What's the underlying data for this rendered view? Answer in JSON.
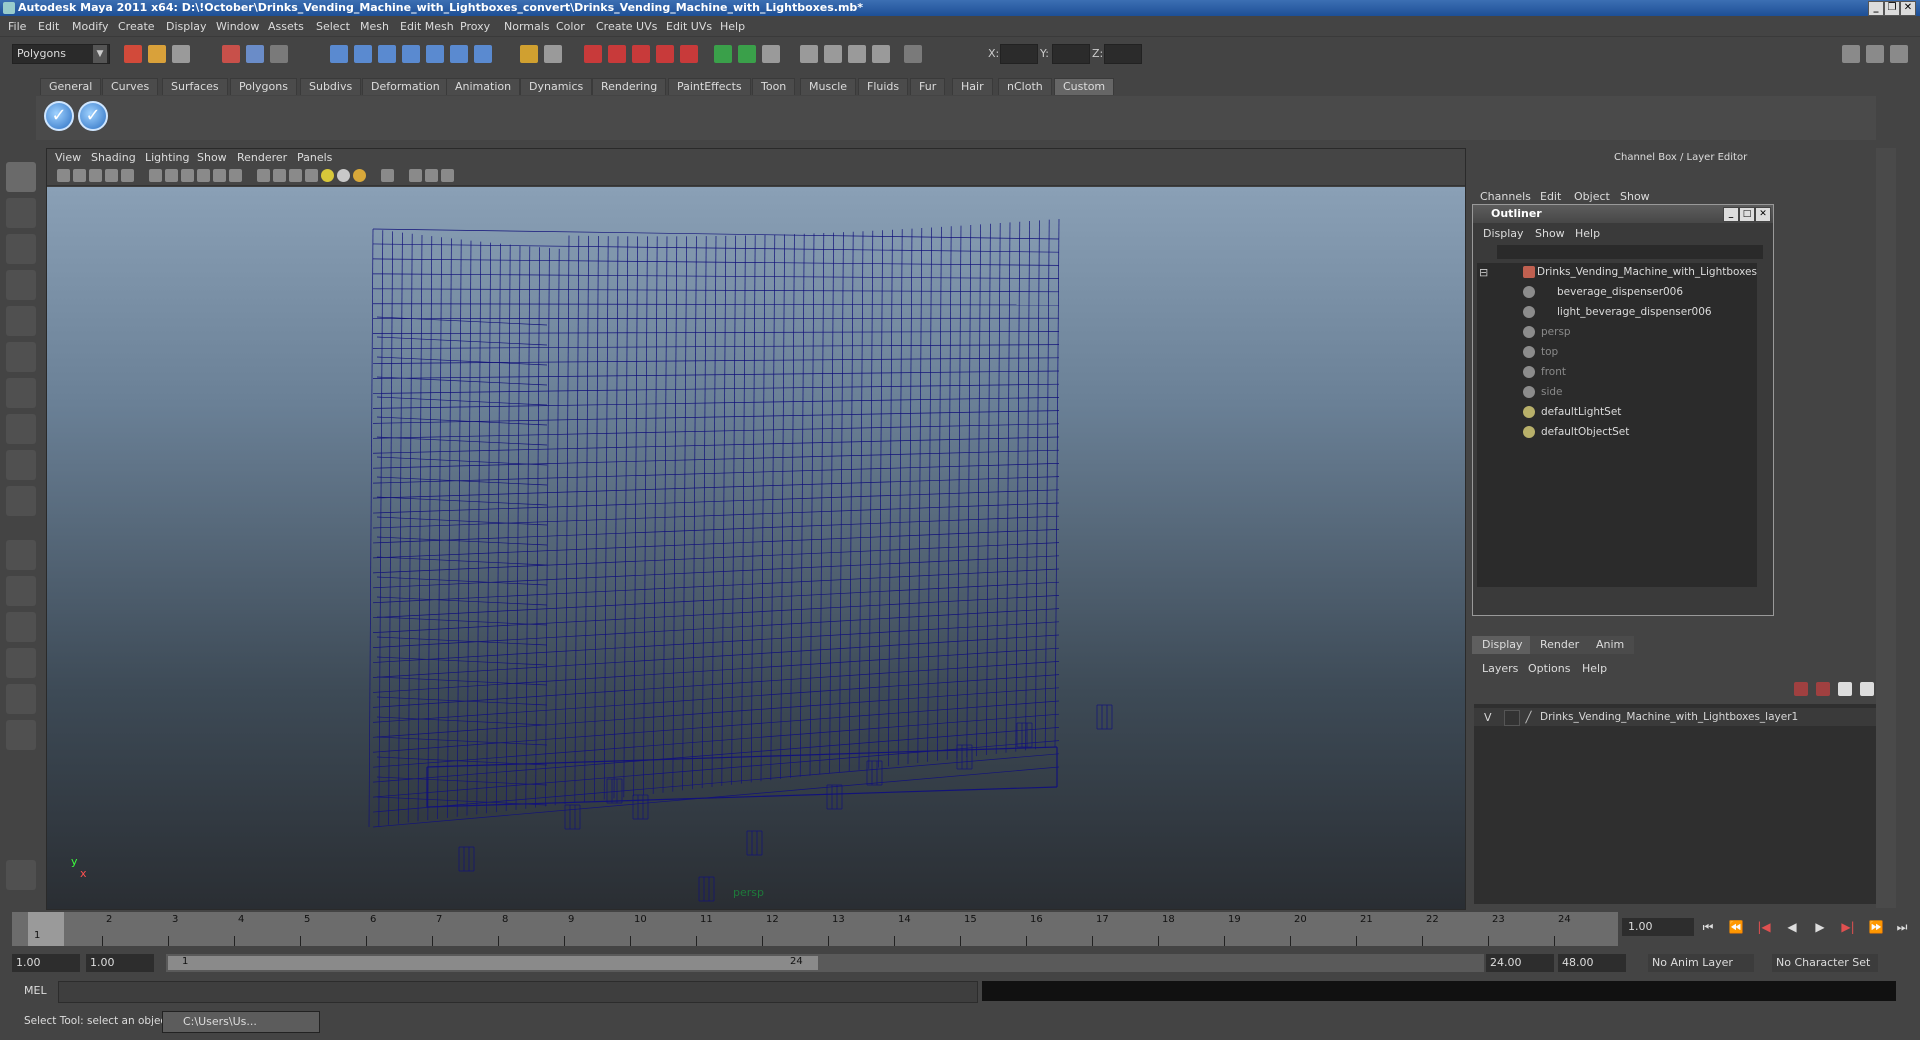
{
  "window": {
    "title": "Autodesk Maya 2011 x64: D:\\!October\\Drinks_Vending_Machine_with_Lightboxes_convert\\Drinks_Vending_Machine_with_Lightboxes.mb*",
    "min_btn": "_",
    "max_btn": "❐",
    "close_btn": "✕"
  },
  "menubar": [
    "File",
    "Edit",
    "Modify",
    "Create",
    "Display",
    "Window",
    "Assets",
    "Select",
    "Mesh",
    "Edit Mesh",
    "Proxy",
    "Normals",
    "Color",
    "Create UVs",
    "Edit UVs",
    "Help"
  ],
  "statusline": {
    "mode": "Polygons",
    "x_label": "X:",
    "y_label": "Y:",
    "z_label": "Z:"
  },
  "shelf": {
    "tabs": [
      "General",
      "Curves",
      "Surfaces",
      "Polygons",
      "Subdivs",
      "Deformation",
      "Animation",
      "Dynamics",
      "Rendering",
      "PaintEffects",
      "Toon",
      "Muscle",
      "Fluids",
      "Fur",
      "Hair",
      "nCloth",
      "Custom"
    ],
    "active_tab": "Custom",
    "check_icon": "✓"
  },
  "viewport": {
    "menu": [
      "View",
      "Shading",
      "Lighting",
      "Show",
      "Renderer",
      "Panels"
    ],
    "camera_label": "persp",
    "axis_y": "y",
    "axis_x": "x",
    "wire_color": "#12127a"
  },
  "channel_box": {
    "title": "Channel Box / Layer Editor",
    "menu": [
      "Channels",
      "Edit",
      "Object",
      "Show"
    ]
  },
  "outliner": {
    "title": "Outliner",
    "menu": [
      "Display",
      "Show",
      "Help"
    ],
    "min_btn": "_",
    "max_btn": "□",
    "close_btn": "✕",
    "collapse": "⊟",
    "items": [
      {
        "label": "Drinks_Vending_Machine_with_Lightboxes",
        "dim": false
      },
      {
        "label": "beverage_dispenser006",
        "dim": false
      },
      {
        "label": "light_beverage_dispenser006",
        "dim": false
      },
      {
        "label": "persp",
        "dim": true
      },
      {
        "label": "top",
        "dim": true
      },
      {
        "label": "front",
        "dim": true
      },
      {
        "label": "side",
        "dim": true
      },
      {
        "label": "defaultLightSet",
        "dim": false
      },
      {
        "label": "defaultObjectSet",
        "dim": false
      }
    ]
  },
  "layer_editor": {
    "tabs": [
      "Display",
      "Render",
      "Anim"
    ],
    "active_tab": "Display",
    "menu": [
      "Layers",
      "Options",
      "Help"
    ],
    "layer": {
      "visible": "V",
      "name": "Drinks_Vending_Machine_with_Lightboxes_layer1"
    }
  },
  "timeline": {
    "ticks": [
      "1",
      "2",
      "3",
      "4",
      "5",
      "6",
      "7",
      "8",
      "9",
      "10",
      "11",
      "12",
      "13",
      "14",
      "15",
      "16",
      "17",
      "18",
      "19",
      "20",
      "21",
      "22",
      "23",
      "24"
    ],
    "current_frame": "1",
    "current_field": "1.00",
    "playback": [
      "⏮",
      "⏪",
      "|◀",
      "◀",
      "▶",
      "▶|",
      "⏩",
      "⏭"
    ]
  },
  "range": {
    "start_time": "1.00",
    "start_range": "1.00",
    "range_start_label": "1",
    "range_end_label": "24",
    "end_range": "24.00",
    "end_time": "48.00",
    "anim_layer": "No Anim Layer",
    "character_set": "No Character Set"
  },
  "command": {
    "mel": "MEL"
  },
  "helpline": {
    "text": "Select Tool: select an object",
    "task": "C:\\Users\\Us..."
  }
}
